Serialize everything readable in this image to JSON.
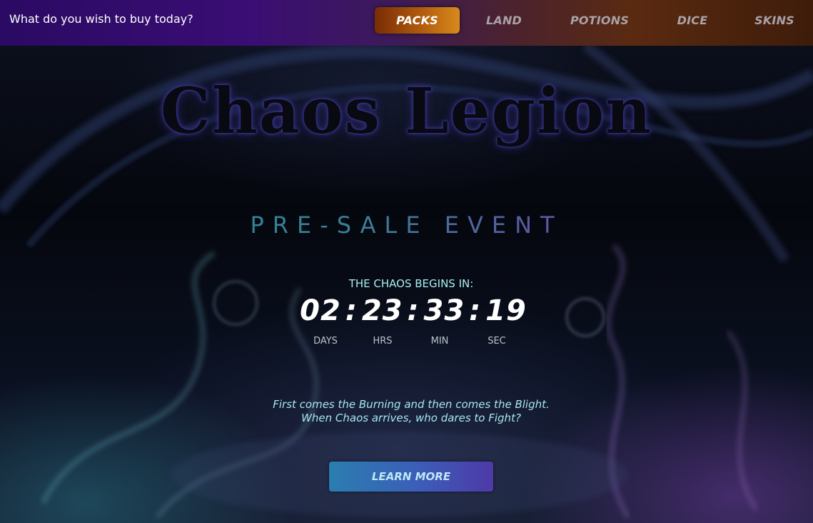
{
  "header": {
    "prompt": "What do you wish to buy today?",
    "nav": [
      {
        "label": "PACKS",
        "active": true
      },
      {
        "label": "LAND",
        "active": false
      },
      {
        "label": "POTIONS",
        "active": false
      },
      {
        "label": "DICE",
        "active": false
      },
      {
        "label": "SKINS",
        "active": false
      }
    ]
  },
  "hero": {
    "logo_text": "Chaos Legion",
    "subtitle": "PRE-SALE EVENT",
    "countdown": {
      "label": "THE CHAOS BEGINS IN:",
      "days": "02",
      "hours": "23",
      "minutes": "33",
      "seconds": "19",
      "separator": ":",
      "units": [
        "DAYS",
        "HRS",
        "MIN",
        "SEC"
      ]
    },
    "tagline_line1": "First comes the Burning and then comes the Blight.",
    "tagline_line2": "When Chaos arrives, who dares to Fight?",
    "cta_label": "LEARN MORE"
  },
  "colors": {
    "accent_orange": "#c8701a",
    "accent_teal": "#1e8f95",
    "accent_purple": "#7c3fae",
    "countdown_label": "#a8eef2"
  }
}
